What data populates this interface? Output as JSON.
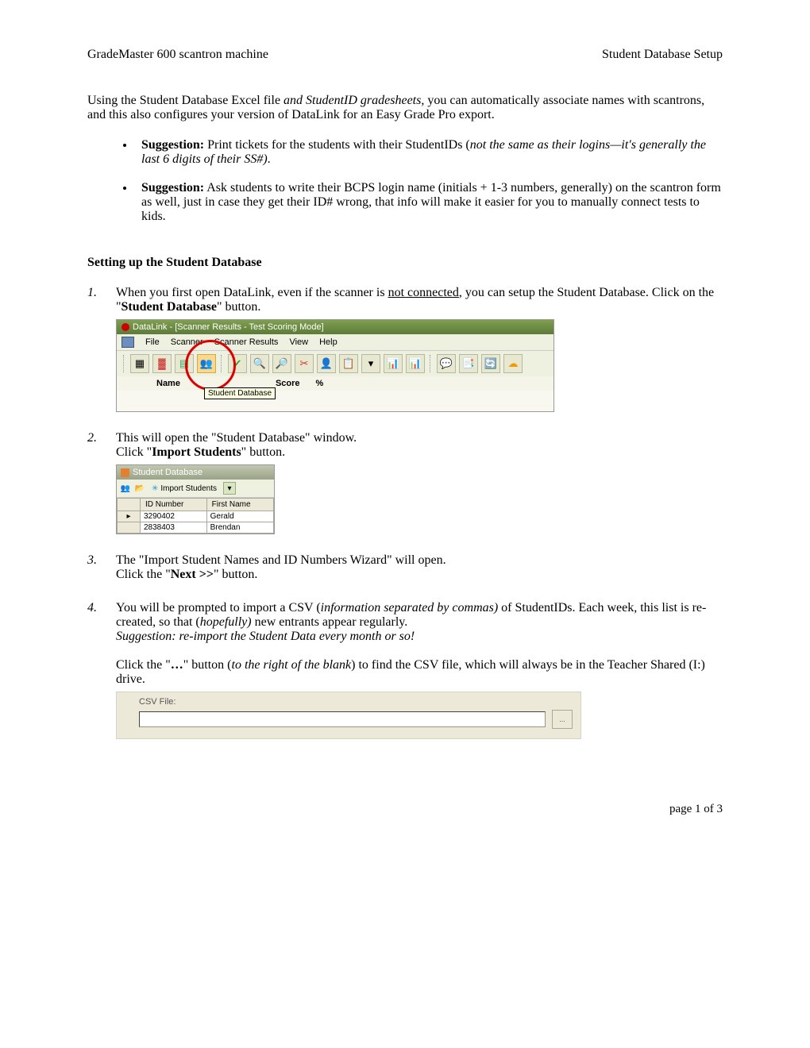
{
  "header": {
    "left": "GradeMaster 600 scantron machine",
    "right": "Student Database Setup"
  },
  "intro": {
    "part1": "Using the Student Database Excel file ",
    "part2_italic": "and StudentID gradesheets",
    "part3": ", you can automatically associate names with scantrons, and this also configures your version of DataLink for an Easy Grade Pro export."
  },
  "suggestions": [
    {
      "label": "Suggestion:",
      "text": " Print tickets for the students with their StudentIDs (",
      "italic": "not the same as their logins—it's generally the last 6 digits of their SS#)",
      "tail": "."
    },
    {
      "label": "Suggestion:",
      "text": " Ask students to write their BCPS login name (initials + 1-3 numbers, generally) on the scantron form as well, just in case they get their ID# wrong, that info will make it easier for you to manually connect tests to kids.",
      "italic": "",
      "tail": ""
    }
  ],
  "section_heading": "Setting up the Student Database",
  "steps": {
    "s1": {
      "num": "1.",
      "t1": "When you first open DataLink, even if the scanner is ",
      "underline": "not connected",
      "t2": ", you can setup the Student Database.  Click on the \"",
      "bold": "Student Database",
      "t3": "\" button."
    },
    "s2": {
      "num": "2.",
      "t1": "This will open the \"Student Database\" window.",
      "t2": "Click \"",
      "bold": "Import Students",
      "t3": "\" button."
    },
    "s3": {
      "num": "3.",
      "t1": "The \"Import Student Names and ID Numbers Wizard\" will open.",
      "t2": "Click the \"",
      "bold": "Next >>",
      "t3": "\" button."
    },
    "s4": {
      "num": "4.",
      "t1": "You will be prompted to import a CSV (",
      "italic1": "information separated by commas)",
      "t2": " of StudentIDs.  Each week, this list is re-created, so that (",
      "italic2": "hopefully)",
      "t3": " new entrants appear regularly.",
      "italic3": "Suggestion: re-import the Student Data every month or so!",
      "t4": "Click the \"",
      "bold": "…",
      "t5": "\" button (",
      "italic4": "to the right of the blank",
      "t6": ") to find the CSV file, which will always be in the Teacher Shared (I:) drive."
    }
  },
  "shot1": {
    "title": "DataLink - [Scanner Results - Test Scoring Mode]",
    "menus": [
      "File",
      "Scanner",
      "Scanner Results",
      "View",
      "Help"
    ],
    "tooltip": "Student Database",
    "cols": {
      "name": "Name",
      "score": "Score",
      "pct": "%"
    }
  },
  "shot2": {
    "title": "Student Database",
    "import_btn": "Import Students",
    "headers": {
      "id": "ID Number",
      "fn": "First Name"
    },
    "rows": [
      {
        "id": "3290402",
        "fn": "Gerald"
      },
      {
        "id": "2838403",
        "fn": "Brendan"
      }
    ]
  },
  "shot3": {
    "label": "CSV File:",
    "btn": "..."
  },
  "footer": "page 1 of 3"
}
